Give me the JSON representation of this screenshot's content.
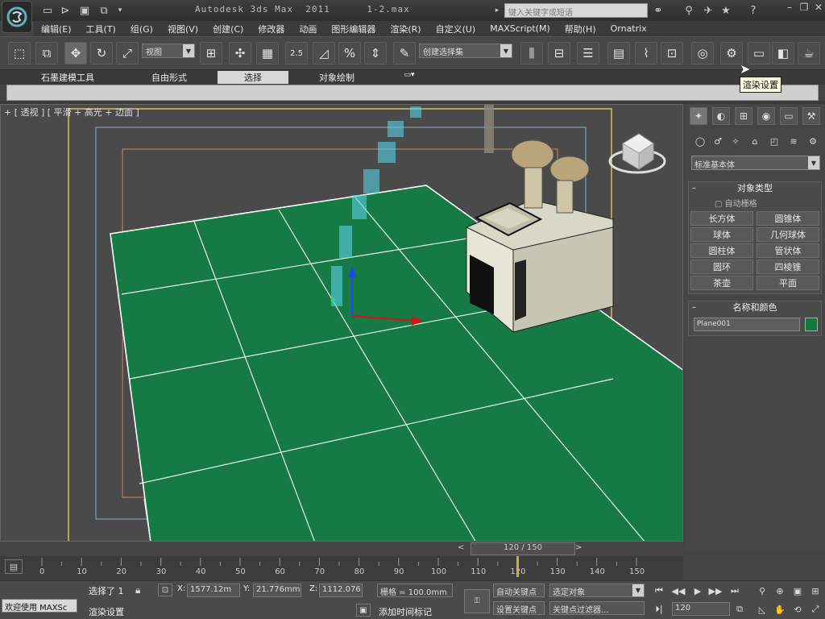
{
  "window": {
    "title": "Autodesk 3ds Max  2011      1-2.max",
    "search_placeholder": "键入关键字或短语"
  },
  "menu": [
    "编辑(E)",
    "工具(T)",
    "组(G)",
    "视图(V)",
    "创建(C)",
    "修改器",
    "动画",
    "图形编辑器",
    "渲染(R)",
    "自定义(U)",
    "MAXScript(M)",
    "帮助(H)",
    "Ornatrix"
  ],
  "toolbar": {
    "view_dropdown": "视图",
    "selection_set_dropdown": "创建选择集",
    "snap_label": "2.5"
  },
  "tooltip": "渲染设置",
  "ribbon": {
    "tabs": [
      "石墨建模工具",
      "自由形式",
      "选择",
      "对象绘制"
    ],
    "active_tab": "选择"
  },
  "viewport": {
    "label": "+ [ 透视 ] [ 平滑 + 高光 + 边面 ]",
    "floor_color": "#157a43",
    "background_color": "#4a4a4a"
  },
  "command_panel": {
    "category_dropdown": "标准基本体",
    "object_type": {
      "title": "对象类型",
      "autogrid": "自动栅格",
      "buttons": [
        "长方体",
        "圆锥体",
        "球体",
        "几何球体",
        "圆柱体",
        "管状体",
        "圆环",
        "四棱锥",
        "茶壶",
        "平面"
      ]
    },
    "name_color": {
      "title": "名称和颜色",
      "name_value": "Plane001",
      "color": "#0f7a3a"
    }
  },
  "timeline": {
    "frame_display": "120 / 150",
    "ticks": [
      "0",
      "10",
      "20",
      "30",
      "40",
      "50",
      "60",
      "70",
      "80",
      "90",
      "100",
      "110",
      "120",
      "130",
      "140",
      "150"
    ],
    "current_frame": 120,
    "total_frames": 150
  },
  "status": {
    "welcome": "欢迎使用  MAXSc",
    "selection": "选择了 1",
    "x_label": "X:",
    "x_value": "1577.12m",
    "y_label": "Y:",
    "y_value": "21.776mm",
    "z_label": "Z:",
    "z_value": "1112.076",
    "grid": "栅格 = 100.0mm",
    "prompt": "渲染设置",
    "add_time_tag": "添加时间标记",
    "auto_key": "自动关键点",
    "set_key": "设置关键点",
    "selected_object": "选定对象",
    "key_filters": "关键点过滤器...",
    "frame_field": "120"
  }
}
